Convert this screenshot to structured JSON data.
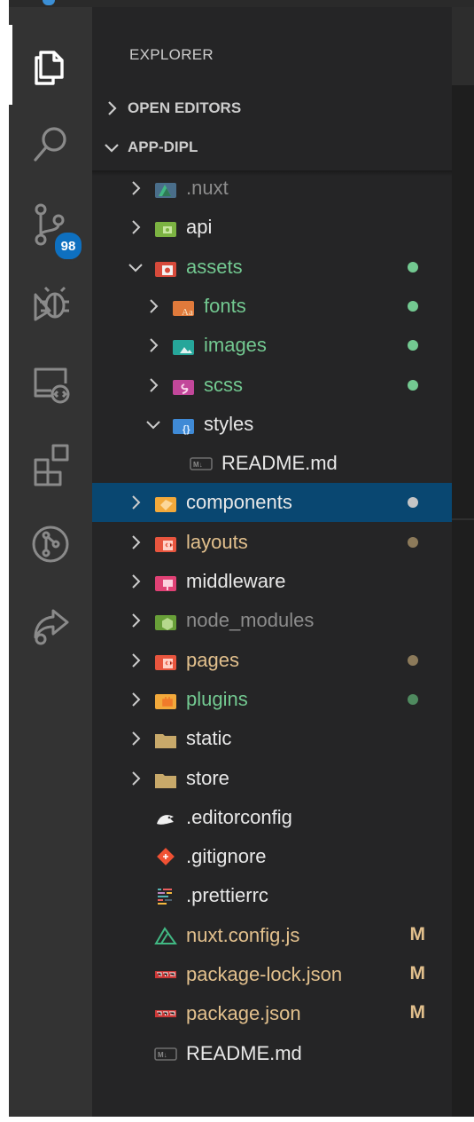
{
  "activity_bar": {
    "items": [
      {
        "icon": "files-icon",
        "active": true
      },
      {
        "icon": "search-icon"
      },
      {
        "icon": "source-control-icon",
        "badge": "98"
      },
      {
        "icon": "debug-icon"
      },
      {
        "icon": "remote-explorer-icon"
      },
      {
        "icon": "extensions-icon"
      },
      {
        "icon": "git-graph-icon"
      },
      {
        "icon": "live-share-icon"
      }
    ]
  },
  "sidebar": {
    "title": "EXPLORER",
    "sections": {
      "open_editors": "OPEN EDITORS",
      "project": "APP-DIPL"
    },
    "tree": [
      {
        "label": ".nuxt",
        "icon": "nuxt-folder-icon",
        "depth": 1,
        "chevron": "right",
        "color": "gray"
      },
      {
        "label": "api",
        "icon": "api-folder-icon",
        "depth": 1,
        "chevron": "right",
        "color": "white"
      },
      {
        "label": "assets",
        "icon": "assets-folder-icon",
        "depth": 1,
        "chevron": "down",
        "color": "green",
        "dot": "#73c991"
      },
      {
        "label": "fonts",
        "icon": "fonts-folder-icon",
        "depth": 2,
        "chevron": "right",
        "color": "green",
        "dot": "#73c991"
      },
      {
        "label": "images",
        "icon": "images-folder-icon",
        "depth": 2,
        "chevron": "right",
        "color": "green",
        "dot": "#73c991"
      },
      {
        "label": "scss",
        "icon": "scss-folder-icon",
        "depth": 2,
        "chevron": "right",
        "color": "green",
        "dot": "#73c991"
      },
      {
        "label": "styles",
        "icon": "styles-folder-icon",
        "depth": 2,
        "chevron": "down",
        "color": "white"
      },
      {
        "label": "README.md",
        "icon": "markdown-icon",
        "depth": 3,
        "chevron": "none",
        "color": "white"
      },
      {
        "label": "components",
        "icon": "components-folder-icon",
        "depth": 1,
        "chevron": "right",
        "color": "white",
        "dot": "#c5c5c5",
        "selected": true
      },
      {
        "label": "layouts",
        "icon": "layouts-folder-icon",
        "depth": 1,
        "chevron": "right",
        "color": "olive",
        "dot": "#8c7a5a"
      },
      {
        "label": "middleware",
        "icon": "middleware-folder-icon",
        "depth": 1,
        "chevron": "right",
        "color": "white"
      },
      {
        "label": "node_modules",
        "icon": "node-modules-folder-icon",
        "depth": 1,
        "chevron": "right",
        "color": "gray"
      },
      {
        "label": "pages",
        "icon": "pages-folder-icon",
        "depth": 1,
        "chevron": "right",
        "color": "olive",
        "dot": "#8c7a5a"
      },
      {
        "label": "plugins",
        "icon": "plugins-folder-icon",
        "depth": 1,
        "chevron": "right",
        "color": "green",
        "dot": "#4f8a5f"
      },
      {
        "label": "static",
        "icon": "folder-icon",
        "depth": 1,
        "chevron": "right",
        "color": "white"
      },
      {
        "label": "store",
        "icon": "folder-icon",
        "depth": 1,
        "chevron": "right",
        "color": "white"
      },
      {
        "label": ".editorconfig",
        "icon": "editorconfig-icon",
        "depth": 1,
        "chevron": "none",
        "color": "white"
      },
      {
        "label": ".gitignore",
        "icon": "git-icon",
        "depth": 1,
        "chevron": "none",
        "color": "white"
      },
      {
        "label": ".prettierrc",
        "icon": "prettier-icon",
        "depth": 1,
        "chevron": "none",
        "color": "white"
      },
      {
        "label": "nuxt.config.js",
        "icon": "nuxt-icon",
        "depth": 1,
        "chevron": "none",
        "color": "olive",
        "mark": "M"
      },
      {
        "label": "package-lock.json",
        "icon": "npm-icon",
        "depth": 1,
        "chevron": "none",
        "color": "olive",
        "mark": "M"
      },
      {
        "label": "package.json",
        "icon": "npm-icon",
        "depth": 1,
        "chevron": "none",
        "color": "olive",
        "mark": "M"
      },
      {
        "label": "README.md",
        "icon": "markdown-icon",
        "depth": 1,
        "chevron": "none",
        "color": "white"
      }
    ]
  }
}
